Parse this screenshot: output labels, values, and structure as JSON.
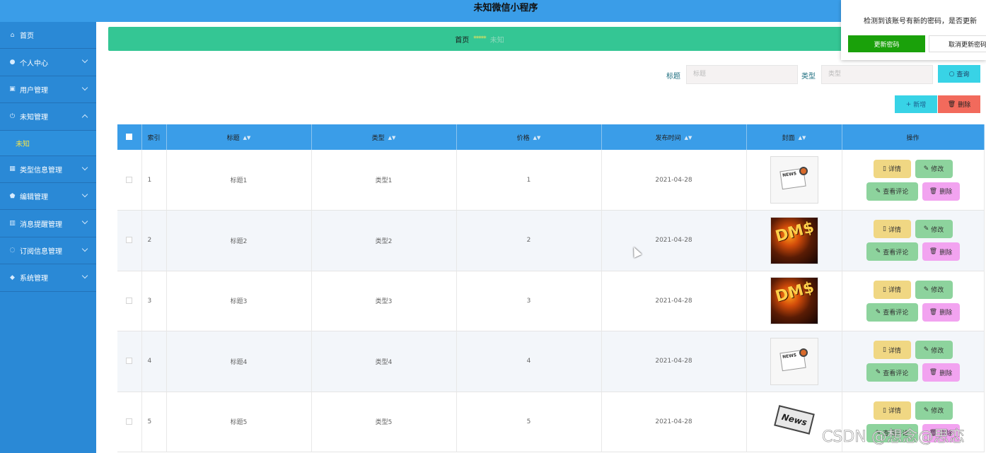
{
  "app": {
    "title": "未知微信小程序"
  },
  "popup": {
    "message": "检测到该账号有新的密码，是否更新",
    "confirm_label": "更新密码",
    "cancel_label": "取消更新密码"
  },
  "sidebar": {
    "items": [
      {
        "label": "首页",
        "icon": "home-icon",
        "has_chevron": false
      },
      {
        "label": "个人中心",
        "icon": "user-icon",
        "has_chevron": true
      },
      {
        "label": "用户管理",
        "icon": "users-icon",
        "has_chevron": true
      },
      {
        "label": "未知管理",
        "icon": "power-icon",
        "has_chevron": true,
        "expanded": true
      },
      {
        "label": "类型信息管理",
        "icon": "grid-icon",
        "has_chevron": true
      },
      {
        "label": "编辑管理",
        "icon": "shield-icon",
        "has_chevron": true
      },
      {
        "label": "消息提醒管理",
        "icon": "chart-icon",
        "has_chevron": true
      },
      {
        "label": "订阅信息管理",
        "icon": "bell-icon",
        "has_chevron": true
      },
      {
        "label": "系统管理",
        "icon": "pin-icon",
        "has_chevron": true
      }
    ],
    "sub_item": "未知"
  },
  "breadcrumb": {
    "home": "首页",
    "separator": "*****",
    "current": "未知"
  },
  "search": {
    "title_label": "标题",
    "title_placeholder": "标题",
    "type_label": "类型",
    "type_placeholder": "类型",
    "query_label": "查询"
  },
  "actions": {
    "add_label": "新增",
    "delete_label": "删除"
  },
  "table": {
    "headers": {
      "index": "索引",
      "title": "标题",
      "type": "类型",
      "price": "价格",
      "date": "发布时间",
      "cover": "封面",
      "ops": "操作"
    },
    "op_labels": {
      "detail": "详情",
      "edit": "修改",
      "comment": "查看评论",
      "delete": "删除"
    },
    "rows": [
      {
        "index": "1",
        "title": "标题1",
        "type": "类型1",
        "price": "1",
        "date": "2021-04-28",
        "cover": "news"
      },
      {
        "index": "2",
        "title": "标题2",
        "type": "类型2",
        "price": "2",
        "date": "2021-04-28",
        "cover": "dark"
      },
      {
        "index": "3",
        "title": "标题3",
        "type": "类型3",
        "price": "3",
        "date": "2021-04-28",
        "cover": "dark"
      },
      {
        "index": "4",
        "title": "标题4",
        "type": "类型4",
        "price": "4",
        "date": "2021-04-28",
        "cover": "news"
      },
      {
        "index": "5",
        "title": "标题5",
        "type": "类型5",
        "price": "5",
        "date": "2021-04-28",
        "cover": "paperstack"
      }
    ]
  },
  "watermark": "CSDN @想念@思恋",
  "colors": {
    "topbar": "#3a9de8",
    "sidebar": "#2a89d6",
    "breadcrumb": "#34c694",
    "confirm": "#1aa10a"
  }
}
